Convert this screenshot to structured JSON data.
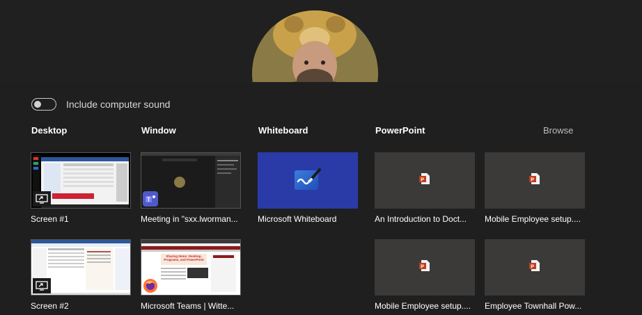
{
  "toggle": {
    "label": "Include computer sound",
    "checked": false
  },
  "columns": {
    "desktop": "Desktop",
    "window": "Window",
    "whiteboard": "Whiteboard",
    "powerpoint": "PowerPoint",
    "browse": "Browse"
  },
  "desktop": [
    {
      "caption": "Screen #1"
    },
    {
      "caption": "Screen #2"
    }
  ],
  "windows": [
    {
      "caption": "Meeting in \"sxx.lworman..."
    },
    {
      "caption": "Microsoft Teams | Witte..."
    }
  ],
  "whiteboard": {
    "caption": "Microsoft Whiteboard"
  },
  "powerpoint": [
    {
      "caption": "An Introduction to Doct..."
    },
    {
      "caption": "Mobile Employee setup...."
    },
    {
      "caption": "Mobile Employee setup...."
    },
    {
      "caption": "Employee Townhall Pow..."
    }
  ],
  "thumb2": {
    "line1": "Sharing Items: Desktop,",
    "line2": "Programs, and PowerPoint"
  },
  "colors": {
    "panel": "#1f1f1f",
    "whiteboard": "#2a3ba8",
    "ppt_tile": "#3b3a39",
    "ppt_red": "#c43e1c"
  }
}
